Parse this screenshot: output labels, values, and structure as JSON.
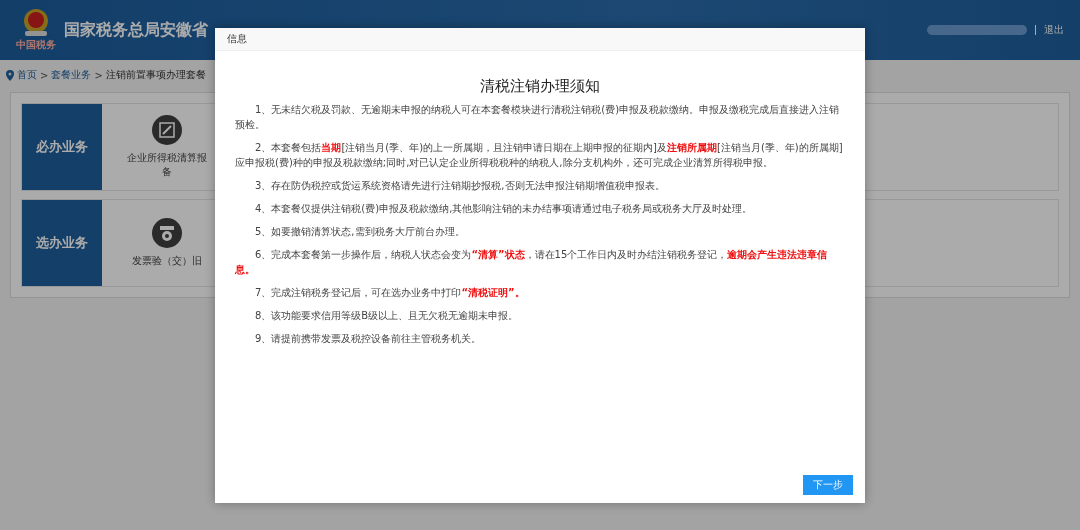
{
  "header": {
    "title": "国家税务总局安徽省",
    "logo_caption": "中国税务",
    "logout": "退出"
  },
  "breadcrumb": {
    "separator": ">",
    "items": [
      "首页",
      "套餐业务",
      "注销前置事项办理套餐"
    ]
  },
  "sections": [
    {
      "label": "必办业务",
      "items": [
        {
          "label": "企业所得税清算报备",
          "kind": "pen"
        }
      ]
    },
    {
      "label": "选办业务",
      "items": [
        {
          "label": "发票验（交）旧",
          "kind": "medal"
        }
      ]
    }
  ],
  "dialog": {
    "title": "信息",
    "heading": "清税注销办理须知",
    "paragraphs": [
      "1、无未结欠税及罚款、无逾期未申报的纳税人可在本套餐模块进行清税注销税(费)申报及税款缴纳。申报及缴税完成后直接进入注销预检。",
      "2、本套餐包括**当期**[注销当月(季、年)的上一所属期，且注销申请日期在上期申报的征期内]及**注销所属期**[注销当月(季、年)的所属期]应申报税(费)种的申报及税款缴纳;同时,对已认定企业所得税税种的纳税人,除分支机构外，还可完成企业清算所得税申报。",
      "3、存在防伪税控或货运系统资格请先进行注销期抄报税,否则无法申报注销期增值税申报表。",
      "4、本套餐仅提供注销税(费)申报及税款缴纳,其他影响注销的未办结事项请通过电子税务局或税务大厅及时处理。",
      "5、如要撤销清算状态,需到税务大厅前台办理。",
      "6、完成本套餐第一步操作后，纳税人状态会变为**“清算”状态**，请在15个工作日内及时办结注销税务登记，**逾期会产生违法违章信息。**",
      "7、完成注销税务登记后，可在选办业务中打印**“清税证明”。**",
      "8、该功能要求信用等级B级以上、且无欠税无逾期未申报。",
      "9、请提前携带发票及税控设备前往主管税务机关。"
    ],
    "button": "下一步"
  }
}
